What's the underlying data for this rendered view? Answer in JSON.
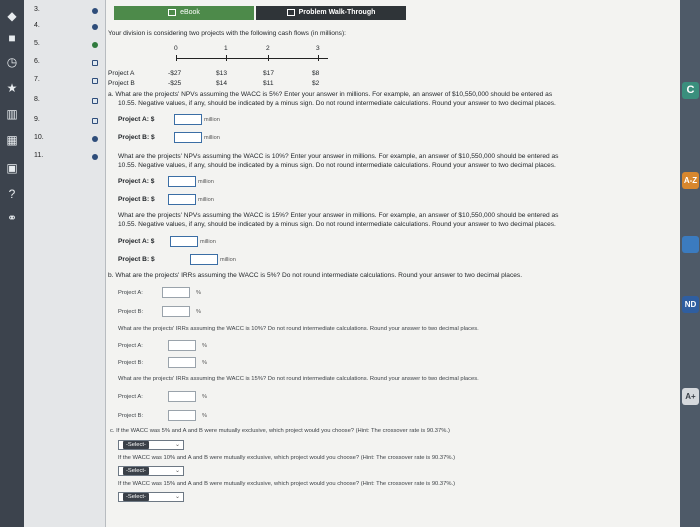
{
  "questions": [
    {
      "num": "3."
    },
    {
      "num": "4."
    },
    {
      "num": "5."
    },
    {
      "num": "6."
    },
    {
      "num": "7."
    },
    {
      "num": "8."
    },
    {
      "num": "9."
    },
    {
      "num": "10."
    },
    {
      "num": "11."
    }
  ],
  "tabs": {
    "ebook": "eBook",
    "walkthrough": "Problem Walk-Through"
  },
  "intro": "Your division is considering two projects with the following cash flows (in millions):",
  "timeline": {
    "periods": [
      "0",
      "1",
      "2",
      "3"
    ]
  },
  "projects": {
    "a": {
      "label": "Project A",
      "flows": [
        "-$27",
        "$13",
        "$17",
        "$8"
      ]
    },
    "b": {
      "label": "Project B",
      "flows": [
        "-$25",
        "$14",
        "$11",
        "$2"
      ]
    }
  },
  "part_a": {
    "q1": "a. What are the projects' NPVs assuming the WACC is 5%? Enter your answer in millions. For example, an answer of $10,550,000 should be entered as",
    "q1b": "10.55. Negative values, if any, should be indicated by a minus sign. Do not round intermediate calculations. Round your answer to two decimal places.",
    "q2": "What are the projects' NPVs assuming the WACC is 10%? Enter your answer in millions. For example, an answer of $10,550,000 should be entered as",
    "q2b": "10.55. Negative values, if any, should be indicated by a minus sign. Do not round intermediate calculations. Round your answer to two decimal places.",
    "q3": "What are the projects' NPVs assuming the WACC is 15%? Enter your answer in millions. For example, an answer of $10,550,000 should be entered as",
    "q3b": "10.55. Negative values, if any, should be indicated by a minus sign. Do not round intermediate calculations. Round your answer to two decimal places.",
    "proj_a": "Project A: $",
    "proj_b": "Project B: $",
    "unit": "million"
  },
  "part_b": {
    "q1": "b. What are the projects' IRRs assuming the WACC is 5%? Do not round intermediate calculations. Round your answer to two decimal places.",
    "q2": "What are the projects' IRRs assuming the WACC is 10%? Do not round intermediate calculations. Round your answer to two decimal places.",
    "q3": "What are the projects' IRRs assuming the WACC is 15%? Do not round intermediate calculations. Round your answer to two decimal places.",
    "proj_a": "Project A:",
    "proj_b": "Project B:",
    "unit": "%"
  },
  "part_c": {
    "q1": "c. If the WACC was 5% and A and B were mutually exclusive, which project would you choose? (Hint: The crossover rate is 90.37%.)",
    "q2": "If the WACC was 10% and A and B were mutually exclusive, which project would you choose? (Hint: The crossover rate is 90.37%.)",
    "q3": "If the WACC was 15% and A and B were mutually exclusive, which project would you choose? (Hint: The crossover rate is 90.37%.)",
    "select_label": "-Select-"
  },
  "right_tiles": [
    "C",
    "A-Z",
    "ND",
    "A+"
  ],
  "colors": {
    "accent": "#3b6ea5",
    "ebook": "#4d8a4a"
  }
}
